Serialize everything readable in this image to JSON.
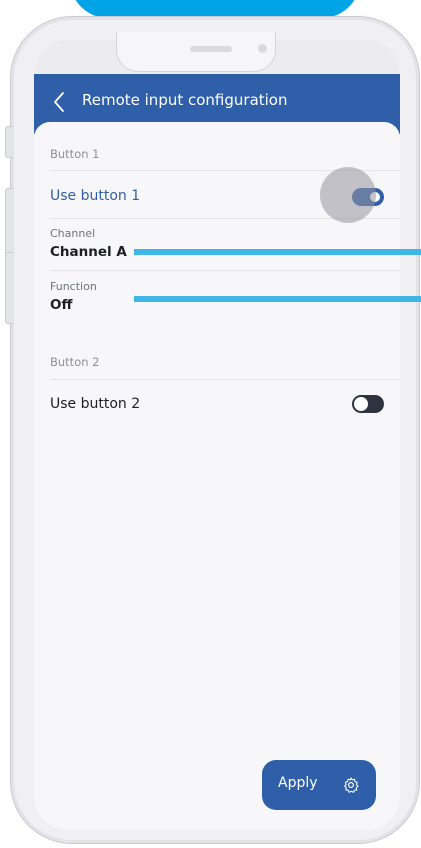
{
  "header": {
    "title": "Remote input configuration",
    "back_icon": "chevron-left-icon"
  },
  "button1": {
    "section_label": "Button 1",
    "toggle_label": "Use button 1",
    "toggle_on": true,
    "channel": {
      "caption": "Channel",
      "value": "Channel A"
    },
    "function": {
      "caption": "Function",
      "value": "Off"
    }
  },
  "button2": {
    "section_label": "Button 2",
    "toggle_label": "Use button 2",
    "toggle_on": false
  },
  "footer": {
    "apply_label": "Apply",
    "apply_icon": "gear-icon"
  },
  "colors": {
    "header_bg": "#2f5fa8",
    "accent_text": "#2f5fa8",
    "callout": "#3fb6e8",
    "ribbon": "#00a3e6",
    "toggle_on": "#2f5fa8",
    "toggle_off": "#2d3440"
  }
}
